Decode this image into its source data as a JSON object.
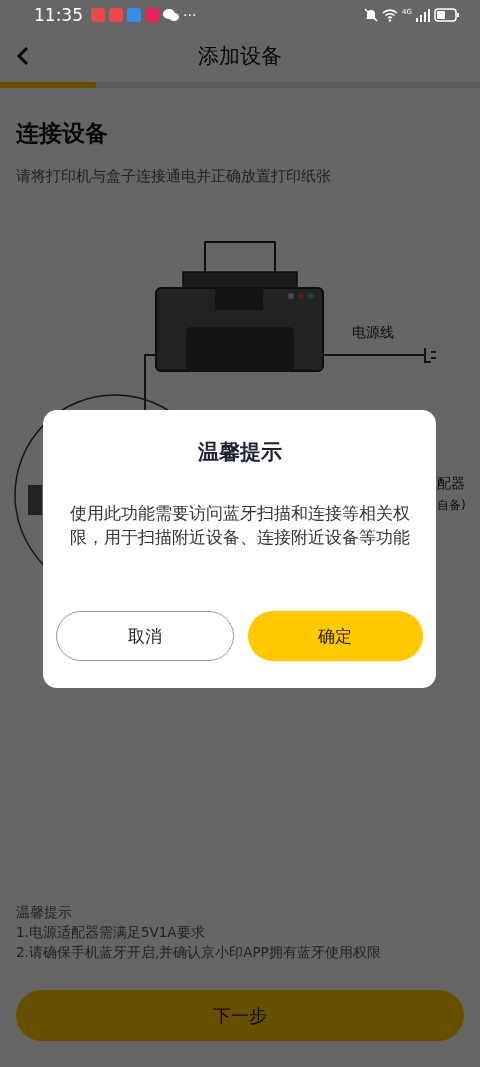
{
  "status_bar": {
    "time": "11:35",
    "more": "···",
    "network": "4G"
  },
  "header": {
    "title": "添加设备"
  },
  "progress": {
    "level": 0.2
  },
  "section": {
    "title": "连接设备",
    "subtitle": "请将打印机与盒子连接通电并正确放置打印纸张"
  },
  "illustration": {
    "power_cable_label": "电源线",
    "adapter_label": "配器",
    "adapter_note": "自备)"
  },
  "tips": {
    "title": "温馨提示",
    "items": [
      "1.电源适配器需满足5V1A要求",
      "2.请确保手机蓝牙开启,并确认京小印APP拥有蓝牙使用权限"
    ]
  },
  "next_button": "下一步",
  "dialog": {
    "title": "温馨提示",
    "message": "使用此功能需要访问蓝牙扫描和连接等相关权限，用于扫描附近设备、连接附近设备等功能",
    "buttons": [
      {
        "label": "取消",
        "kind": "secondary"
      },
      {
        "label": "确定",
        "kind": "primary"
      }
    ]
  }
}
